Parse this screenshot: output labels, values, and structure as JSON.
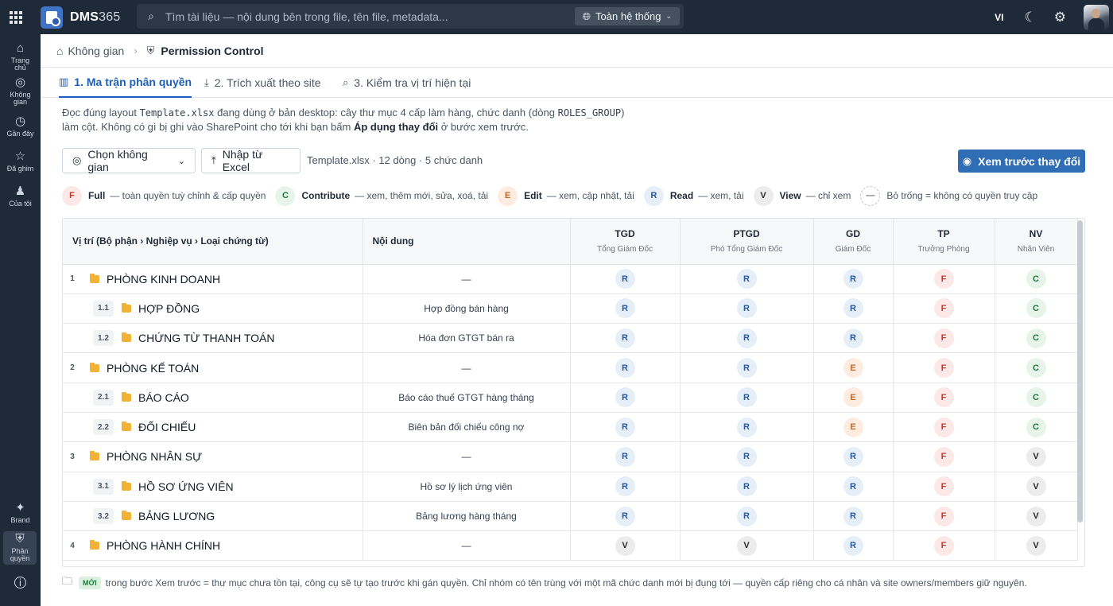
{
  "app": {
    "brand_main": "DMS",
    "brand_num": "365",
    "search_placeholder": "Tìm tài liệu — nội dung bên trong file, tên file, metadata...",
    "scope_label": "Toàn hệ thống",
    "lang": "VI"
  },
  "sidebar": {
    "items": [
      {
        "label": "Trang chủ",
        "icon": "home-icon"
      },
      {
        "label": "Không gian",
        "icon": "globe-icon"
      },
      {
        "label": "Gần đây",
        "icon": "clock-icon"
      },
      {
        "label": "Đã ghim",
        "icon": "star-icon"
      },
      {
        "label": "Của tôi",
        "icon": "user-icon"
      }
    ],
    "bottom": [
      {
        "label": "Brand",
        "icon": "sparkle-icon"
      },
      {
        "label": "Phân quyền",
        "icon": "shield-icon"
      }
    ]
  },
  "breadcrumb": {
    "space": "Không gian",
    "current": "Permission Control"
  },
  "tabs": [
    {
      "label": "1. Ma trận phân quyền",
      "icon": "columns-icon"
    },
    {
      "label": "2. Trích xuất theo site",
      "icon": "download-icon"
    },
    {
      "label": "3. Kiểm tra vị trí hiện tại",
      "icon": "search-icon"
    }
  ],
  "description": {
    "p1": "Đọc đúng layout ",
    "code1": "Template.xlsx",
    "p2": " đang dùng ở bản desktop: cây thư mục 4 cấp làm hàng, chức danh (dòng ",
    "code2": "ROLES_GROUP",
    "p3": ") làm cột. Không có gì bị ghi vào SharePoint cho tới khi bạn bấm ",
    "bold": "Áp dụng thay đổi",
    "p4": " ở bước xem trước."
  },
  "toolbar": {
    "choose_space": "Chọn không gian",
    "import_excel": "Nhập từ Excel",
    "meta": "Template.xlsx · 12 dòng · 5 chức danh",
    "preview": "Xem trước thay đổi"
  },
  "legend": [
    {
      "code": "F",
      "key": "Full",
      "desc": "— toàn quyền tuỳ chỉnh & cấp quyền"
    },
    {
      "code": "C",
      "key": "Contribute",
      "desc": "— xem, thêm mới, sửa, xoá, tải"
    },
    {
      "code": "E",
      "key": "Edit",
      "desc": "— xem, cập nhật, tải"
    },
    {
      "code": "R",
      "key": "Read",
      "desc": "— xem, tải"
    },
    {
      "code": "V",
      "key": "View",
      "desc": "— chỉ xem"
    },
    {
      "code": "—",
      "key": "",
      "desc": "Bỏ trống = không có quyền truy cập"
    }
  ],
  "table": {
    "col_position": "Vị trí (Bộ phận › Nghiệp vụ › Loại chứng từ)",
    "col_content": "Nội dung",
    "roles": [
      {
        "code": "TGD",
        "name": "Tổng Giám Đốc"
      },
      {
        "code": "PTGD",
        "name": "Phó Tổng Giám Đốc"
      },
      {
        "code": "GD",
        "name": "Giám Đốc"
      },
      {
        "code": "TP",
        "name": "Trưởng Phòng"
      },
      {
        "code": "NV",
        "name": "Nhân Viên"
      }
    ],
    "rows": [
      {
        "idx": "1",
        "level": 1,
        "name": "PHÒNG KINH DOANH",
        "content": "—",
        "perms": [
          "R",
          "R",
          "R",
          "F",
          "C"
        ]
      },
      {
        "idx": "1.1",
        "level": 2,
        "name": "HỢP ĐỒNG",
        "content": "Hợp đồng bán hàng",
        "perms": [
          "R",
          "R",
          "R",
          "F",
          "C"
        ]
      },
      {
        "idx": "1.2",
        "level": 2,
        "name": "CHỨNG TỪ THANH TOÁN",
        "content": "Hóa đơn GTGT bán ra",
        "perms": [
          "R",
          "R",
          "R",
          "F",
          "C"
        ]
      },
      {
        "idx": "2",
        "level": 1,
        "name": "PHÒNG KẾ TOÁN",
        "content": "—",
        "perms": [
          "R",
          "R",
          "E",
          "F",
          "C"
        ]
      },
      {
        "idx": "2.1",
        "level": 2,
        "name": "BÁO CÁO",
        "content": "Báo cáo thuế GTGT hàng tháng",
        "perms": [
          "R",
          "R",
          "E",
          "F",
          "C"
        ]
      },
      {
        "idx": "2.2",
        "level": 2,
        "name": "ĐỐI CHIẾU",
        "content": "Biên bản đối chiếu công nợ",
        "perms": [
          "R",
          "R",
          "E",
          "F",
          "C"
        ]
      },
      {
        "idx": "3",
        "level": 1,
        "name": "PHÒNG NHÂN SỰ",
        "content": "—",
        "perms": [
          "R",
          "R",
          "R",
          "F",
          "V"
        ]
      },
      {
        "idx": "3.1",
        "level": 2,
        "name": "HỒ SƠ ỨNG VIÊN",
        "content": "Hồ sơ lý lịch ứng viên",
        "perms": [
          "R",
          "R",
          "R",
          "F",
          "V"
        ]
      },
      {
        "idx": "3.2",
        "level": 2,
        "name": "BẢNG LƯƠNG",
        "content": "Bảng lương hàng tháng",
        "perms": [
          "R",
          "R",
          "R",
          "F",
          "V"
        ]
      },
      {
        "idx": "4",
        "level": 1,
        "name": "PHÒNG HÀNH CHÍNH",
        "content": "—",
        "perms": [
          "V",
          "V",
          "R",
          "F",
          "V"
        ]
      }
    ]
  },
  "footnote": {
    "tag": "MỚI",
    "text": "trong bước Xem trước = thư mục chưa tồn tại, công cụ sẽ tự tạo trước khi gán quyền. Chỉ nhóm có tên trùng với một mã chức danh mới bị đụng tới — quyền cấp riêng cho cá nhân và site owners/members giữ nguyên."
  }
}
